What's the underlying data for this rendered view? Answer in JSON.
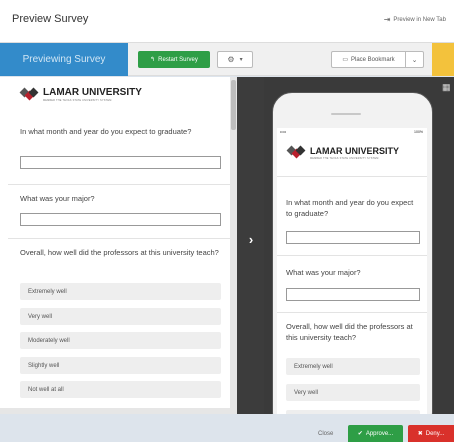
{
  "header": {
    "title": "Preview Survey",
    "preview_new_tab": "Preview in New Tab"
  },
  "toolbar": {
    "previewing_label": "Previewing Survey",
    "restart_label": "Restart Survey",
    "bookmark_label": "Place Bookmark"
  },
  "survey": {
    "logo_name": "LAMAR UNIVERSITY",
    "logo_tagline": "MEMBER THE TEXAS STATE UNIVERSITY SYSTEM",
    "questions": [
      {
        "text": "In what month and year do you expect to graduate?"
      },
      {
        "text": "What was your major?"
      },
      {
        "text": "Overall, how well did the professors at this university teach?"
      }
    ],
    "options": [
      "Extremely well",
      "Very well",
      "Moderately well",
      "Slightly well",
      "Not well at all"
    ]
  },
  "device": {
    "status_signal": "•••••",
    "status_battery": "100%",
    "logo_name": "LAMAR UNIVERSITY",
    "logo_tagline": "MEMBER THE TEXAS STATE UNIVERSITY SYSTEM"
  },
  "footer": {
    "close_label": "Close",
    "approve_label": "Approve...",
    "deny_label": "Deny..."
  },
  "colors": {
    "previewing_bg": "#1f81c6",
    "restart_bg": "#2e9e46",
    "approve_bg": "#2e9e46",
    "deny_bg": "#d9312b",
    "bookmark_accent": "#f3c23c",
    "logo_red": "#b8202c"
  }
}
